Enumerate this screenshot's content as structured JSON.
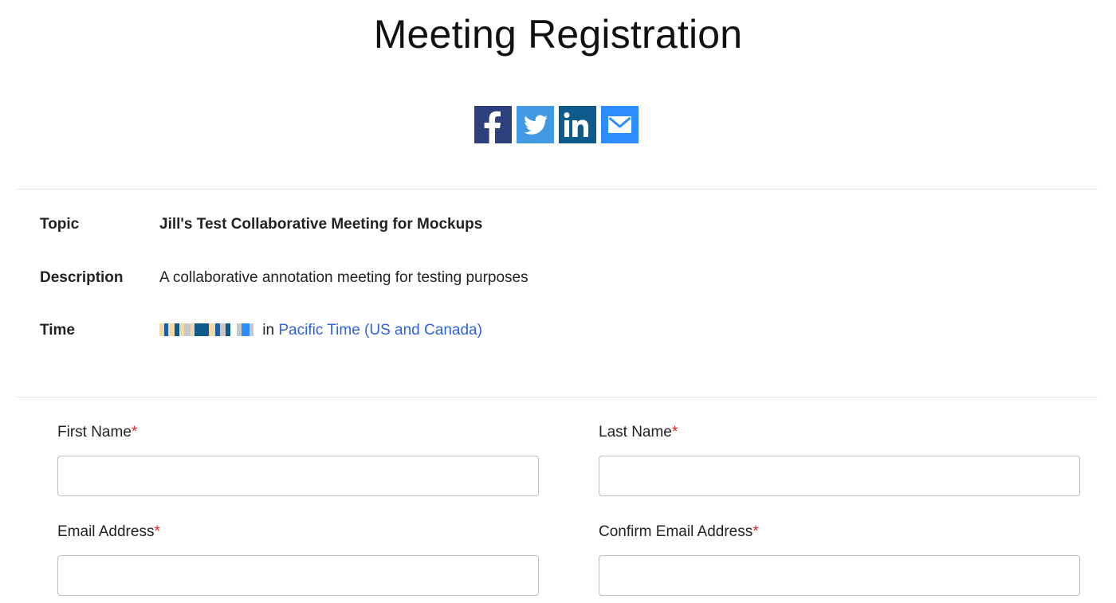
{
  "page": {
    "title": "Meeting Registration"
  },
  "share": {
    "buttons": [
      {
        "name": "facebook",
        "icon": "facebook-icon",
        "color": "#2d3f7d"
      },
      {
        "name": "twitter",
        "icon": "twitter-icon",
        "color": "#4299e3"
      },
      {
        "name": "linkedin",
        "icon": "linkedin-icon",
        "color": "#0e5a8a"
      },
      {
        "name": "email",
        "icon": "envelope-icon",
        "color": "#2d8cff"
      }
    ]
  },
  "meeting": {
    "topic_label": "Topic",
    "topic": "Jill's Test Collaborative Meeting for Mockups",
    "description_label": "Description",
    "description": "A collaborative annotation meeting for testing purposes",
    "time_label": "Time",
    "time_value_redacted": true,
    "time_in": "in",
    "timezone": "Pacific Time (US and Canada)"
  },
  "form": {
    "required_marker": "*",
    "fields": [
      {
        "label": "First Name",
        "value": "",
        "placeholder": ""
      },
      {
        "label": "Last Name",
        "value": "",
        "placeholder": ""
      },
      {
        "label": "Email Address",
        "value": "",
        "placeholder": ""
      },
      {
        "label": "Confirm Email Address",
        "value": "",
        "placeholder": ""
      }
    ]
  },
  "colors": {
    "link": "#2d63e0",
    "required": "#e8261f",
    "divider": "#e6e6e6"
  }
}
